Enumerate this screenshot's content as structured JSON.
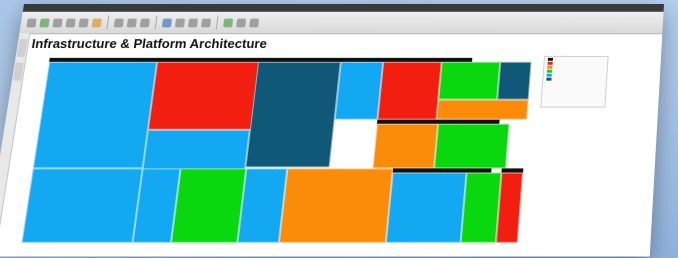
{
  "report_title": "Infrastructure & Platform Architecture",
  "colors": {
    "blue": "#12a8f2",
    "red": "#f21f10",
    "teal": "#0f5877",
    "green": "#08d80d",
    "orange": "#fb8c09",
    "header": "#111111"
  },
  "toolbar_icons": [
    "new-icon",
    "open-icon",
    "save-icon",
    "print-icon",
    "undo-icon",
    "redo-icon",
    "cut-icon",
    "copy-icon",
    "paste-icon",
    "chart-icon",
    "filter-icon",
    "sort-icon",
    "refresh-icon",
    "zoom-icon",
    "settings-icon",
    "help-icon"
  ],
  "legend": {
    "colors": [
      "#111111",
      "#f21f10",
      "#fb8c09",
      "#08d80d",
      "#12a8f2",
      "#0f5877"
    ]
  },
  "treemap": {
    "groups": [
      {
        "id": "g1"
      },
      {
        "id": "g2"
      },
      {
        "id": "g3"
      },
      {
        "id": "g4"
      },
      {
        "id": "g5"
      },
      {
        "id": "g6"
      },
      {
        "id": "g7"
      }
    ],
    "tiles": [
      {
        "color": "blue"
      },
      {
        "color": "red"
      },
      {
        "color": "teal"
      },
      {
        "color": "blue"
      },
      {
        "color": "red"
      },
      {
        "color": "green"
      },
      {
        "color": "teal"
      },
      {
        "color": "blue"
      },
      {
        "color": "orange"
      },
      {
        "color": "green"
      },
      {
        "color": "orange"
      },
      {
        "color": "blue"
      },
      {
        "color": "blue"
      },
      {
        "color": "blue"
      },
      {
        "color": "green"
      },
      {
        "color": "blue"
      },
      {
        "color": "orange"
      },
      {
        "color": "blue"
      },
      {
        "color": "green"
      },
      {
        "color": "red"
      }
    ]
  }
}
